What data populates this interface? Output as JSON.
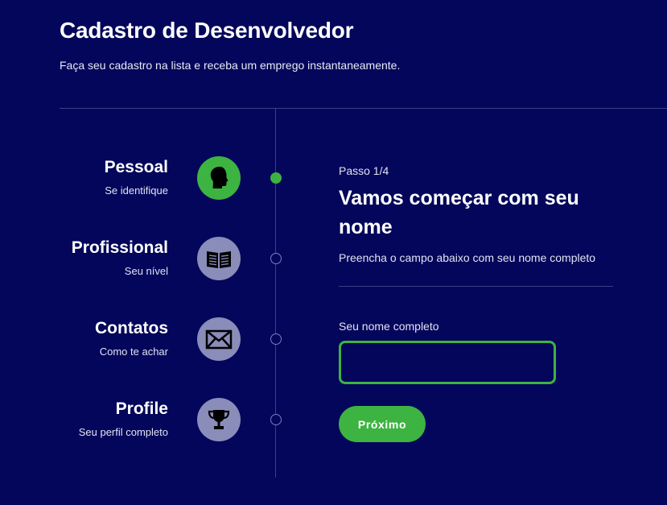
{
  "header": {
    "title": "Cadastro de Desenvolvedor",
    "subtitle": "Faça seu cadastro na lista e receba um emprego instantaneamente."
  },
  "steps": [
    {
      "name": "Pessoal",
      "desc": "Se identifique",
      "icon": "head-profile-icon",
      "active": true
    },
    {
      "name": "Profissional",
      "desc": "Seu nível",
      "icon": "book-icon",
      "active": false
    },
    {
      "name": "Contatos",
      "desc": "Como te achar",
      "icon": "envelope-icon",
      "active": false
    },
    {
      "name": "Profile",
      "desc": "Seu perfil completo",
      "icon": "trophy-icon",
      "active": false
    }
  ],
  "form": {
    "step_count": "Passo 1/4",
    "heading": "Vamos começar com seu nome",
    "description": "Preencha o campo abaixo com seu nome completo",
    "field_label": "Seu nome completo",
    "field_value": "",
    "button_label": "Próximo"
  },
  "colors": {
    "background": "#03065a",
    "accent": "#3db341",
    "inactive_icon": "#8a8cb9",
    "divider": "#3b3f86"
  }
}
